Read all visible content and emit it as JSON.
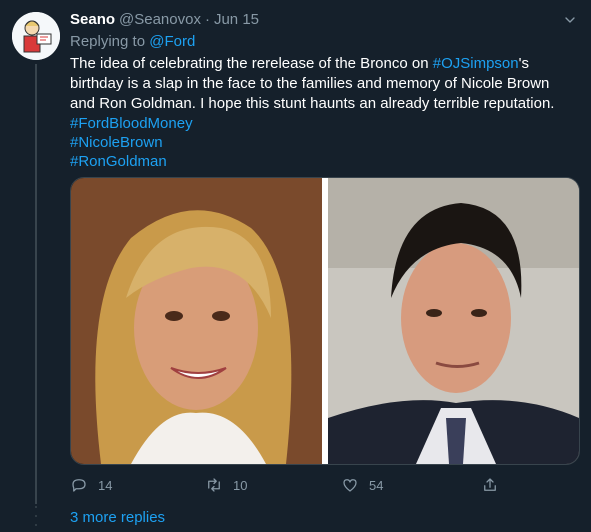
{
  "tweet": {
    "name": "Seano",
    "handle": "@Seanovox",
    "separator": "·",
    "date": "Jun 15",
    "replying_prefix": "Replying to ",
    "replying_to": "@Ford",
    "text_before": "The idea of celebrating the rerelease of the Bronco on ",
    "mention_hashtag": "#OJSimpson",
    "text_after": "'s birthday is a slap in the face to the families and memory of Nicole Brown and Ron Goldman. I hope this stunt haunts an already terrible reputation.",
    "hashtags": [
      "#FordBloodMoney",
      "#NicoleBrown",
      "#RonGoldman"
    ]
  },
  "actions": {
    "replies": "14",
    "retweets": "10",
    "likes": "54"
  },
  "more_replies": "3 more replies",
  "colors": {
    "background": "#15202b",
    "accent": "#1da1f2",
    "muted": "#8899a6"
  },
  "icons": {
    "avatar": "cartoon-avatar",
    "menu": "chevron-down-icon",
    "reply": "reply-icon",
    "retweet": "retweet-icon",
    "like": "heart-icon",
    "share": "share-icon"
  }
}
